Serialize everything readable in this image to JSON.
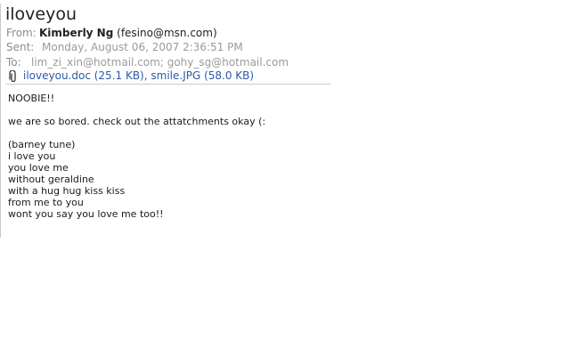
{
  "header": {
    "subject": "iloveyou",
    "from_label": "From:",
    "from_name": "Kimberly Ng",
    "from_email": "(fesino@msn.com)",
    "sent_label": "Sent:",
    "sent_value": "Monday, August 06, 2007 2:36:51 PM",
    "to_label": "To:",
    "to_value": "lim_zi_xin@hotmail.com; gohy_sg@hotmail.com"
  },
  "attachments": {
    "icon": "paperclip-icon",
    "items": [
      "iloveyou.doc (25.1 KB)",
      "smile.JPG (58.0 KB)"
    ],
    "separator": ","
  },
  "message": {
    "greeting": "NOOBIE!!",
    "intro": "we are so bored. check out the attatchments okay (:",
    "song_lines": [
      "(barney tune)",
      "i love you",
      "you love me",
      "without geraldine",
      "with a hug hug kiss kiss",
      "from me to you",
      "wont you say you love me too!!"
    ]
  },
  "colors": {
    "label": "#8c8c8c",
    "link": "#2a5aa8",
    "rule": "#c9c9c9"
  }
}
